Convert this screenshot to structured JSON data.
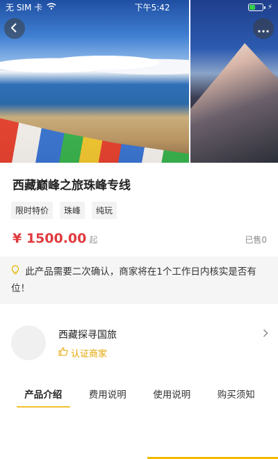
{
  "status_bar": {
    "carrier": "无 SIM 卡",
    "time": "下午5:42",
    "battery_color": "#36d14a"
  },
  "hero": {
    "back_icon": "chevron-left-icon",
    "more_icon": "more-horizontal-icon"
  },
  "product": {
    "title": "西藏巅峰之旅珠峰专线",
    "tags": [
      "限时特价",
      "珠峰",
      "纯玩"
    ],
    "price": "¥ 1500.00",
    "price_suffix": "起",
    "sold": "已售0",
    "price_color": "#e03a3e"
  },
  "notice": {
    "icon": "lightbulb-icon",
    "text": "此产品需要二次确认，商家将在1个工作日内核实是否有位！"
  },
  "merchant": {
    "name": "西藏探寻国旅",
    "badge": "认证商家",
    "badge_color": "#e4a400"
  },
  "tabs": [
    {
      "label": "产品介绍",
      "active": true
    },
    {
      "label": "费用说明",
      "active": false
    },
    {
      "label": "使用说明",
      "active": false
    },
    {
      "label": "购买须知",
      "active": false
    }
  ],
  "accent_color": "#f1c22c"
}
